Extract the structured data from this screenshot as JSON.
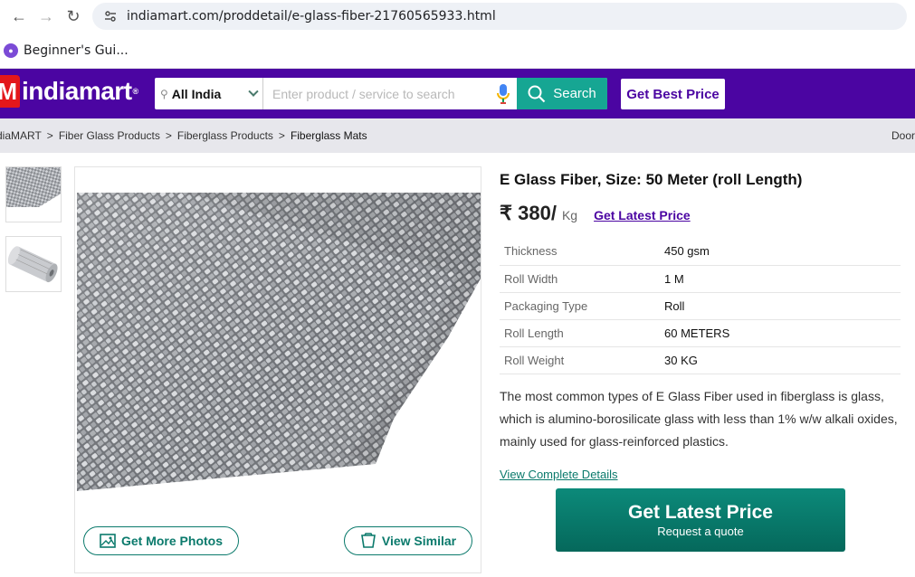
{
  "browser": {
    "url": "indiamart.com/proddetail/e-glass-fiber-21760565933.html",
    "bookmark_label": "Beginner's Gui..."
  },
  "header": {
    "logo_text": "indiamart",
    "location": "All India",
    "search_placeholder": "Enter product / service to search",
    "search_label": "Search",
    "best_price_label": "Get Best Price",
    "brand_color": "#4b05a2",
    "accent_color": "#16a693"
  },
  "breadcrumb": {
    "items": [
      "diaMART",
      "Fiber Glass Products",
      "Fiberglass Products",
      "Fiberglass Mats"
    ],
    "right_text": "Door"
  },
  "gallery": {
    "more_photos_label": "Get More Photos",
    "view_similar_label": "View Similar"
  },
  "product": {
    "title": "E Glass Fiber, Size: 50 Meter (roll Length)",
    "price": "₹ 380/",
    "unit": "Kg",
    "latest_price_link": "Get Latest Price",
    "specs": [
      {
        "key": "Thickness",
        "value": "450 gsm"
      },
      {
        "key": "Roll Width",
        "value": "1 M"
      },
      {
        "key": "Packaging Type",
        "value": "Roll"
      },
      {
        "key": "Roll Length",
        "value": "60 METERS"
      },
      {
        "key": "Roll Weight",
        "value": "30 KG"
      }
    ],
    "description": "The most common types of E Glass Fiber used in fiberglass is glass, which is alumino-borosilicate glass with less than 1% w/w alkali oxides, mainly used for glass-reinforced plastics.",
    "complete_details_link": "View Complete Details"
  },
  "cta": {
    "title": "Get Latest Price",
    "subtitle": "Request a quote"
  }
}
